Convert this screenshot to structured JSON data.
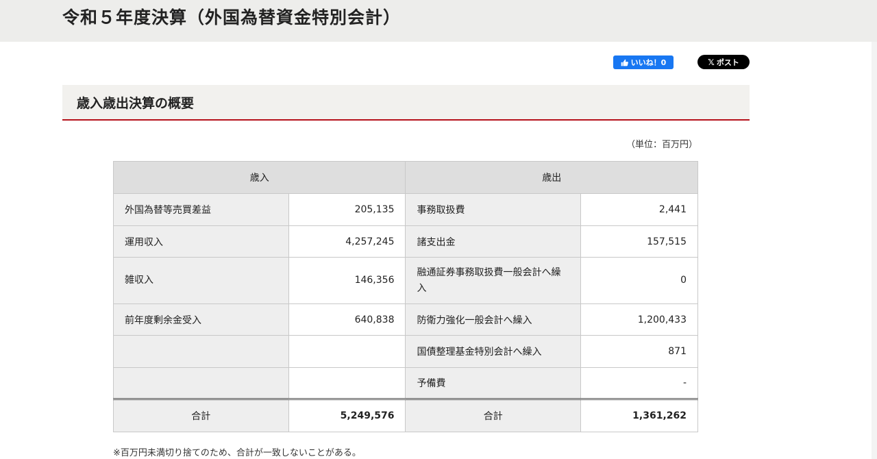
{
  "header": {
    "title": "令和５年度決算（外国為替資金特別会計）"
  },
  "social": {
    "like_label": "いいね！0",
    "post_label": "ポスト",
    "post_x": "𝕏"
  },
  "section": {
    "title": "歳入歳出決算の概要"
  },
  "unit_note": "（単位：百万円）",
  "table": {
    "revenue_header": "歳入",
    "expenditure_header": "歳出",
    "rows": [
      {
        "rev_label": "外国為替等売買差益",
        "rev_value": "205,135",
        "exp_label": "事務取扱費",
        "exp_value": "2,441"
      },
      {
        "rev_label": "運用収入",
        "rev_value": "4,257,245",
        "exp_label": "諸支出金",
        "exp_value": "157,515"
      },
      {
        "rev_label": "雑収入",
        "rev_value": "146,356",
        "exp_label": "融通証券事務取扱費一般会計へ繰入",
        "exp_value": "0"
      },
      {
        "rev_label": "前年度剰余金受入",
        "rev_value": "640,838",
        "exp_label": "防衛力強化一般会計へ繰入",
        "exp_value": "1,200,433"
      },
      {
        "rev_label": "",
        "rev_value": "",
        "exp_label": "国債整理基金特別会計へ繰入",
        "exp_value": "871"
      },
      {
        "rev_label": "",
        "rev_value": "",
        "exp_label": "予備費",
        "exp_value": "-"
      }
    ],
    "total": {
      "rev_label": "合計",
      "rev_value": "5,249,576",
      "exp_label": "合計",
      "exp_value": "1,361,262"
    }
  },
  "footnote": "※百万円未満切り捨てのため、合計が一致しないことがある。",
  "colors": {
    "accent_line": "#b5121b",
    "facebook": "#1877f2",
    "x_button": "#000000"
  }
}
